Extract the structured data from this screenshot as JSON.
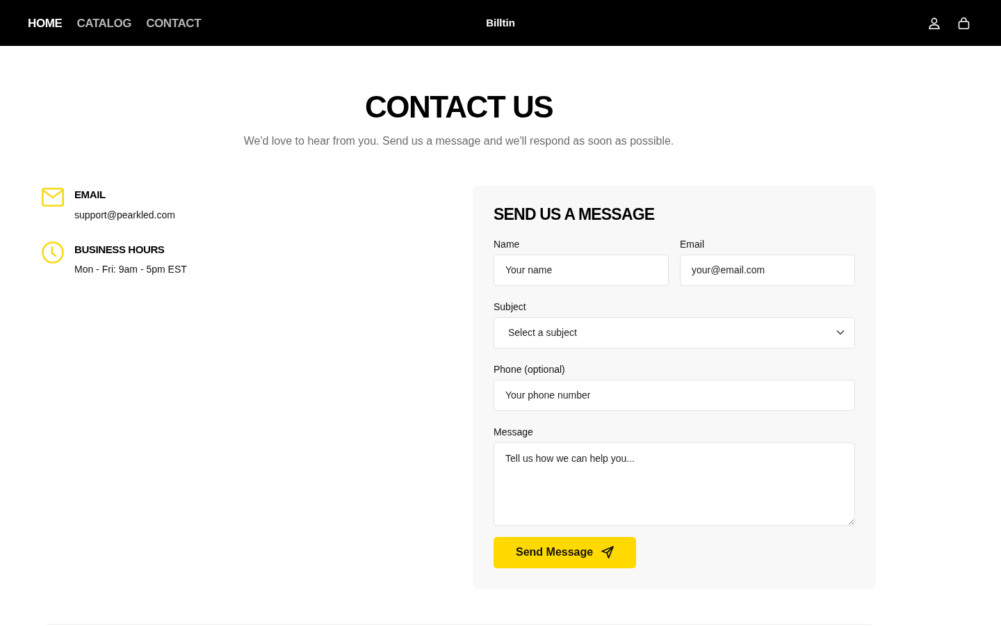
{
  "navbar": {
    "links": [
      {
        "label": "HOME",
        "selected": true
      },
      {
        "label": "CATALOG",
        "selected": false
      },
      {
        "label": "CONTACT",
        "selected": false
      }
    ],
    "brand": "Billtin"
  },
  "header": {
    "title": "CONTACT US",
    "subtitle": "We'd love to hear from you. Send us a message and we'll respond as soon as possible."
  },
  "contact_info": [
    {
      "kind": "email",
      "title": "EMAIL",
      "value": "support@pearkled.com"
    },
    {
      "kind": "hours",
      "title": "BUSINESS HOURS",
      "value": "Mon - Fri: 9am - 5pm EST"
    }
  ],
  "form": {
    "title": "SEND US A MESSAGE",
    "rows": [
      [
        {
          "kind": "input",
          "label": "Name",
          "placeholder": "Your name"
        },
        {
          "kind": "input",
          "label": "Email",
          "placeholder": "your@email.com"
        }
      ],
      [
        {
          "kind": "select",
          "label": "Subject",
          "value": "Select a subject"
        }
      ],
      [
        {
          "kind": "input",
          "label": "Phone (optional)",
          "placeholder": "Your phone number"
        }
      ],
      [
        {
          "kind": "textarea",
          "label": "Message",
          "placeholder": "Tell us how we can help you..."
        }
      ]
    ],
    "submit": "Send Message"
  }
}
